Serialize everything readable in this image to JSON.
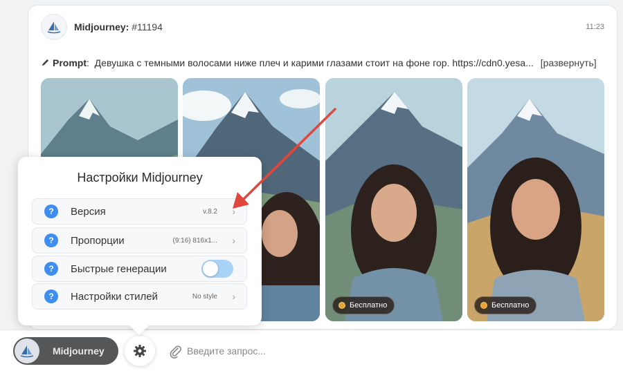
{
  "message": {
    "author": "Midjourney:",
    "job_id": "#11194",
    "time": "11:23",
    "prompt_label": "Prompt",
    "prompt_text": "Девушка с темными волосами ниже плеч и карими глазами стоит на фоне гор. https://cdn0.yesa...",
    "expand_label": "[развернуть]",
    "free_badge_label": "Бесплатно"
  },
  "settings": {
    "title": "Настройки Midjourney",
    "rows": [
      {
        "label": "Версия",
        "value": "v.8.2"
      },
      {
        "label": "Пропорции",
        "value": "(9:16) 816x1..."
      },
      {
        "label": "Быстрые генерации",
        "toggle": false
      },
      {
        "label": "Настройки стилей",
        "value": "No style"
      }
    ]
  },
  "composer": {
    "model_label": "Midjourney",
    "placeholder": "Введите запрос..."
  },
  "colors": {
    "accent": "#3d8ef0",
    "annotation_arrow": "#e0483e",
    "toggle_off": "#a9d2f7"
  }
}
